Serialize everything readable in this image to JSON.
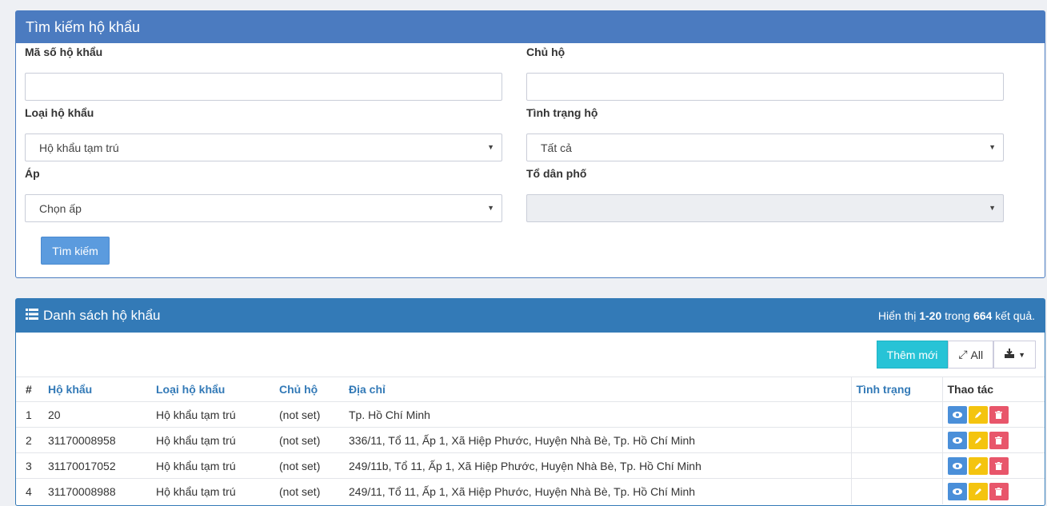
{
  "search": {
    "title": "Tìm kiếm hộ khẩu",
    "fields": {
      "ma_so": {
        "label": "Mã số hộ khẩu",
        "value": ""
      },
      "chu_ho": {
        "label": "Chủ hộ",
        "value": ""
      },
      "loai": {
        "label": "Loại hộ khẩu",
        "value": "Hộ khẩu tạm trú"
      },
      "tinh_trang": {
        "label": "Tình trạng hộ",
        "value": "Tất cả"
      },
      "ap": {
        "label": "Áp",
        "value": "Chọn ấp"
      },
      "to_dan_pho": {
        "label": "Tổ dân phố",
        "value": ""
      }
    },
    "button": "Tìm kiếm"
  },
  "list": {
    "title": "Danh sách hộ khẩu",
    "summary": {
      "prefix": "Hiển thị ",
      "range": "1-20",
      "middle": " trong ",
      "total": "664",
      "suffix": " kết quả."
    },
    "toolbar": {
      "add": "Thêm mới",
      "all": "All"
    },
    "columns": [
      "#",
      "Hộ khẩu",
      "Loại hộ khẩu",
      "Chủ hộ",
      "Địa chỉ",
      "Tình trạng",
      "Thao tác"
    ],
    "rows": [
      {
        "idx": "1",
        "ho_khau": "20",
        "loai": "Hộ khẩu tạm trú",
        "chu_ho": "(not set)",
        "dia_chi": "Tp. Hồ Chí Minh",
        "tinh_trang": ""
      },
      {
        "idx": "2",
        "ho_khau": "31170008958",
        "loai": "Hộ khẩu tạm trú",
        "chu_ho": "(not set)",
        "dia_chi": "336/11, Tổ 11, Ấp 1, Xã Hiệp Phước, Huyện Nhà Bè, Tp. Hồ Chí Minh",
        "tinh_trang": ""
      },
      {
        "idx": "3",
        "ho_khau": "31170017052",
        "loai": "Hộ khẩu tạm trú",
        "chu_ho": "(not set)",
        "dia_chi": "249/11b, Tổ 11, Ấp 1, Xã Hiệp Phước, Huyện Nhà Bè, Tp. Hồ Chí Minh",
        "tinh_trang": ""
      },
      {
        "idx": "4",
        "ho_khau": "31170008988",
        "loai": "Hộ khẩu tạm trú",
        "chu_ho": "(not set)",
        "dia_chi": "249/11, Tổ 11, Ấp 1, Xã Hiệp Phước, Huyện Nhà Bè, Tp. Hồ Chí Minh",
        "tinh_trang": ""
      }
    ]
  }
}
